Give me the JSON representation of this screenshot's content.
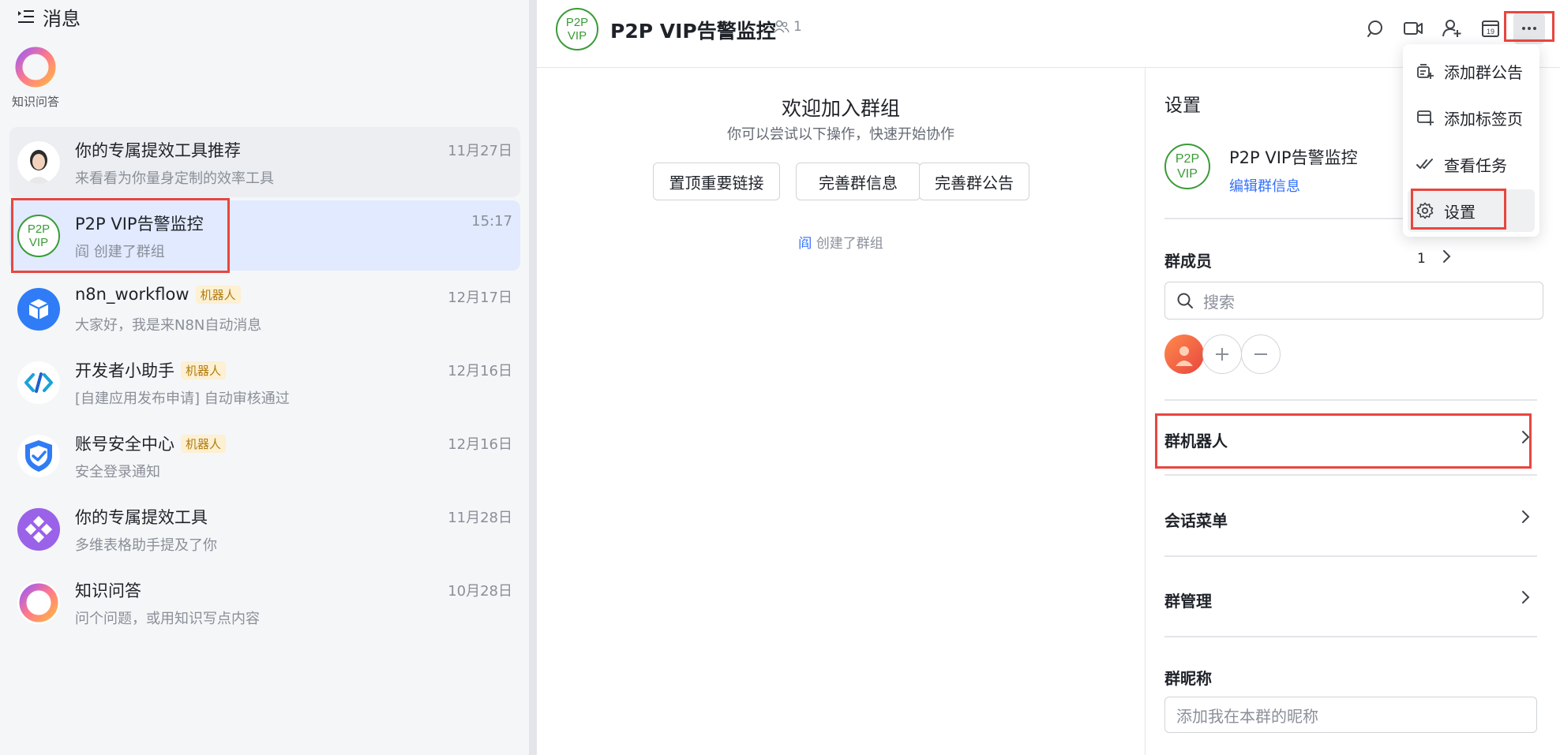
{
  "left_panel": {
    "title": "消息",
    "pinned": {
      "label": "知识问答"
    }
  },
  "chats": [
    {
      "name": "你的专属提效工具推荐",
      "preview": "来看看为你量身定制的效率工具",
      "time": "11月27日",
      "bot": false
    },
    {
      "name": "P2P VIP告警监控",
      "preview": "阎 创建了群组",
      "time": "15:17",
      "bot": false
    },
    {
      "name": "n8n_workflow",
      "preview": "大家好，我是来N8N自动消息",
      "time": "12月17日",
      "bot": true
    },
    {
      "name": "开发者小助手",
      "preview": "[自建应用发布申请] 自动审核通过",
      "time": "12月16日",
      "bot": true
    },
    {
      "name": "账号安全中心",
      "preview": "安全登录通知",
      "time": "12月16日",
      "bot": true
    },
    {
      "name": "你的专属提效工具",
      "preview": "多维表格助手提及了你",
      "time": "11月28日",
      "bot": false
    },
    {
      "name": "知识问答",
      "preview": "问个问题，或用知识写点内容",
      "time": "10月28日",
      "bot": false
    }
  ],
  "bot_tag": "机器人",
  "avatar_text": {
    "line1": "P2P",
    "line2": "VIP"
  },
  "header": {
    "title": "P2P VIP告警监控",
    "member_count": "1",
    "calendar_day": "19"
  },
  "welcome": {
    "heading": "欢迎加入群组",
    "subheading": "你可以尝试以下操作，快速开始协作",
    "buttons": [
      "置顶重要链接",
      "完善群信息",
      "完善群公告"
    ],
    "system_user": "阎",
    "system_action": " 创建了群组"
  },
  "settings": {
    "title": "设置",
    "group_name": "P2P VIP告警监控",
    "edit_link": "编辑群信息",
    "members_label": "群成员",
    "members_count": "1",
    "search_placeholder": "搜索",
    "group_bots": "群机器人",
    "chat_menu": "会话菜单",
    "group_manage": "群管理",
    "nickname_label": "群昵称",
    "nickname_placeholder": "添加我在本群的昵称"
  },
  "dropdown": {
    "items": [
      "添加群公告",
      "添加标签页",
      "查看任务",
      "设置"
    ]
  },
  "colors": {
    "accent": "#3370ff",
    "highlight_red": "#e8463f",
    "group_avatar_green": "#3a9b37",
    "active_chat_bg": "#e1eaff",
    "bot_tag_bg": "#fdf0d3"
  }
}
